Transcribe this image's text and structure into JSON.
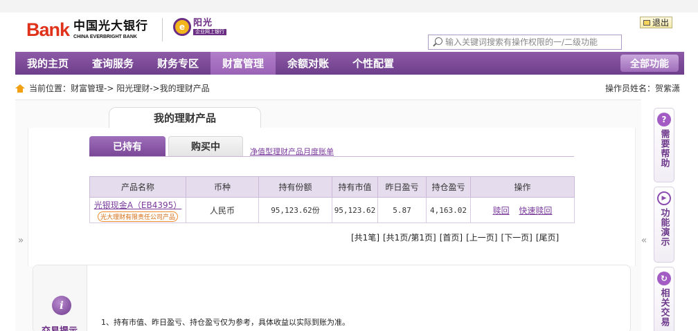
{
  "header": {
    "bank_logo_mark": "Bank",
    "bank_name_cn": "中国光大银行",
    "bank_name_en": "CHINA EVERBRIGHT BANK",
    "sub_brand_title": "阳光",
    "sub_brand_sub": "企业网上银行",
    "logout_label": "退出",
    "search_placeholder": "输入关键词搜索有操作权限的一/二级功能"
  },
  "nav": {
    "items": [
      {
        "label": "我的主页"
      },
      {
        "label": "查询服务"
      },
      {
        "label": "财务专区"
      },
      {
        "label": "财富管理",
        "active": true
      },
      {
        "label": "余额对账"
      },
      {
        "label": "个性配置"
      }
    ],
    "all_functions_label": "全部功能"
  },
  "breadcrumb": {
    "text": "当前位置：财富管理-> 阳光理财->我的理财产品"
  },
  "operator": {
    "text": "操作员姓名：贺紫潇"
  },
  "panel": {
    "title": "我的理财产品",
    "tabs": [
      {
        "label": "已持有",
        "active": true
      },
      {
        "label": "购买中",
        "active": false
      }
    ],
    "monthly_statement_link": "净值型理财产品月度账单",
    "table": {
      "headers": [
        "产品名称",
        "币种",
        "持有份额",
        "持有市值",
        "昨日盈亏",
        "持仓盈亏",
        "操作"
      ],
      "rows": [
        {
          "product_name": "光银现金A（EB4395）",
          "product_badge": "光大理财有限责任公司产品",
          "currency": "人民币",
          "shares": "95,123.62份",
          "market_value": "95,123.62",
          "yesterday_pnl": "5.87",
          "position_pnl": "4,163.02",
          "actions": [
            "赎回",
            "快速赎回"
          ]
        }
      ]
    },
    "pager": [
      "[共1笔]",
      "[共1页/第1页]",
      "[首页]",
      "[上一页]",
      "[下一页]",
      "[尾页]"
    ]
  },
  "tips": {
    "title": "交易提示",
    "line1": "1、持有市值、昨日盈亏、持仓盈亏仅为参考，具体收益以实际到账为准。"
  },
  "sidebar": {
    "help": "需要帮助",
    "demo": "功能演示",
    "related": "相关交易"
  },
  "colors": {
    "brand_purple": "#6e3e8b",
    "brand_red": "#e0321a",
    "link_purple": "#7a3a9c"
  }
}
